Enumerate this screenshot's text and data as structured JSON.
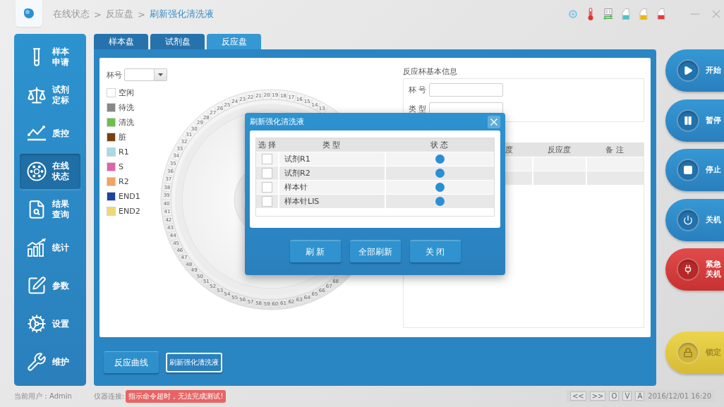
{
  "breadcrumb": [
    {
      "kind": "link",
      "label": "在线状态"
    },
    {
      "kind": "separator",
      "label": ">"
    },
    {
      "kind": "link",
      "label": "反应盘"
    },
    {
      "kind": "separator",
      "label": ">"
    },
    {
      "kind": "current",
      "label": "刷新强化清洗液"
    }
  ],
  "status_icons": [
    {
      "kind": "sensor"
    },
    {
      "kind": "thermometer"
    },
    {
      "kind": "usb"
    },
    {
      "kind": "bottle",
      "color": "#4cc3c3"
    },
    {
      "kind": "bottle",
      "color": "#f2b400"
    },
    {
      "kind": "bottle",
      "color": "#e03c3c"
    }
  ],
  "sidebar": {
    "items": [
      {
        "label": "样本申请",
        "selected": false
      },
      {
        "label": "试剂定标",
        "selected": false
      },
      {
        "label": "质控",
        "selected": false
      },
      {
        "label": "在线状态",
        "selected": true
      },
      {
        "label": "结果查询",
        "selected": false
      },
      {
        "label": "统计",
        "selected": false
      },
      {
        "label": "参数",
        "selected": false
      },
      {
        "label": "设置",
        "selected": false
      },
      {
        "label": "维护",
        "selected": false
      }
    ]
  },
  "tabs": [
    {
      "label": "样本盘",
      "selected": false
    },
    {
      "label": "试剂盘",
      "selected": false
    },
    {
      "label": "反应盘",
      "selected": true
    }
  ],
  "cup_selector": {
    "label": "杯号"
  },
  "legend": [
    {
      "label": "空闲",
      "color": "#ffffff"
    },
    {
      "label": "待洗",
      "color": "#888888"
    },
    {
      "label": "清洗",
      "color": "#6cc04a"
    },
    {
      "label": "脏",
      "color": "#7b3f14"
    },
    {
      "label": "R1",
      "color": "#a6dbe4"
    },
    {
      "label": "S",
      "color": "#e063a8"
    },
    {
      "label": "R2",
      "color": "#f5a262"
    },
    {
      "label": "END1",
      "color": "#1c43a0"
    },
    {
      "label": "END2",
      "color": "#f0d873"
    }
  ],
  "reaction_disk": {
    "upper_arc": [
      "30",
      "29",
      "28",
      "27",
      "26",
      "25",
      "24",
      "23",
      "22",
      "21",
      "20",
      "19",
      "18",
      "17",
      "16",
      "15",
      "14",
      "13"
    ],
    "lower_arc": [
      "31",
      "32",
      "33",
      "34",
      "35",
      "36",
      "37",
      "38",
      "39",
      "40",
      "41",
      "42",
      "43",
      "44",
      "45",
      "46",
      "47",
      "48",
      "49",
      "50",
      "51",
      "52",
      "53",
      "54",
      "55",
      "56",
      "57",
      "58",
      "59",
      "60",
      "61",
      "62",
      "63",
      "64",
      "65",
      "66",
      "67",
      "68"
    ]
  },
  "cup_info": {
    "title": "反应杯基本信息",
    "fields": [
      {
        "label": "杯 号"
      },
      {
        "label": "类 型"
      }
    ]
  },
  "result_table": {
    "columns": [
      "度",
      "反应度",
      "备 注"
    ]
  },
  "bottom_buttons": [
    {
      "label": "反应曲线",
      "focused": false
    },
    {
      "label": "刷新强化清洗液",
      "focused": true
    }
  ],
  "actions": [
    {
      "kind": "start",
      "label": "开始"
    },
    {
      "kind": "pause",
      "label": "暂停"
    },
    {
      "kind": "stop",
      "label": "停止"
    },
    {
      "kind": "shutdown",
      "label": "关机"
    },
    {
      "kind": "emergency",
      "label": "紧急关机"
    },
    {
      "kind": "lock",
      "label": "锁定"
    }
  ],
  "dialog": {
    "title": "刷新强化清洗液",
    "columns": [
      "选 择",
      "类 型",
      "状 态"
    ],
    "rows": [
      {
        "type": "试剂R1",
        "checked": false,
        "color": "#2a8fd4"
      },
      {
        "type": "试剂R2",
        "checked": false,
        "color": "#2a8fd4"
      },
      {
        "type": "样本针",
        "checked": false,
        "color": "#2a8fd4"
      },
      {
        "type": "样本针LIS",
        "checked": false,
        "color": "#2a8fd4"
      }
    ],
    "buttons": [
      "刷 新",
      "全部刷新",
      "关 闭"
    ]
  },
  "status_bar": {
    "user": "当前用户：Admin",
    "connection_label": "仪器连接:",
    "alert": "指示命令超时，无法完成测试!",
    "nav_buttons": [
      "<<",
      ">>",
      "O",
      "V",
      "A"
    ],
    "datetime": "2016/12/01 16:20"
  }
}
